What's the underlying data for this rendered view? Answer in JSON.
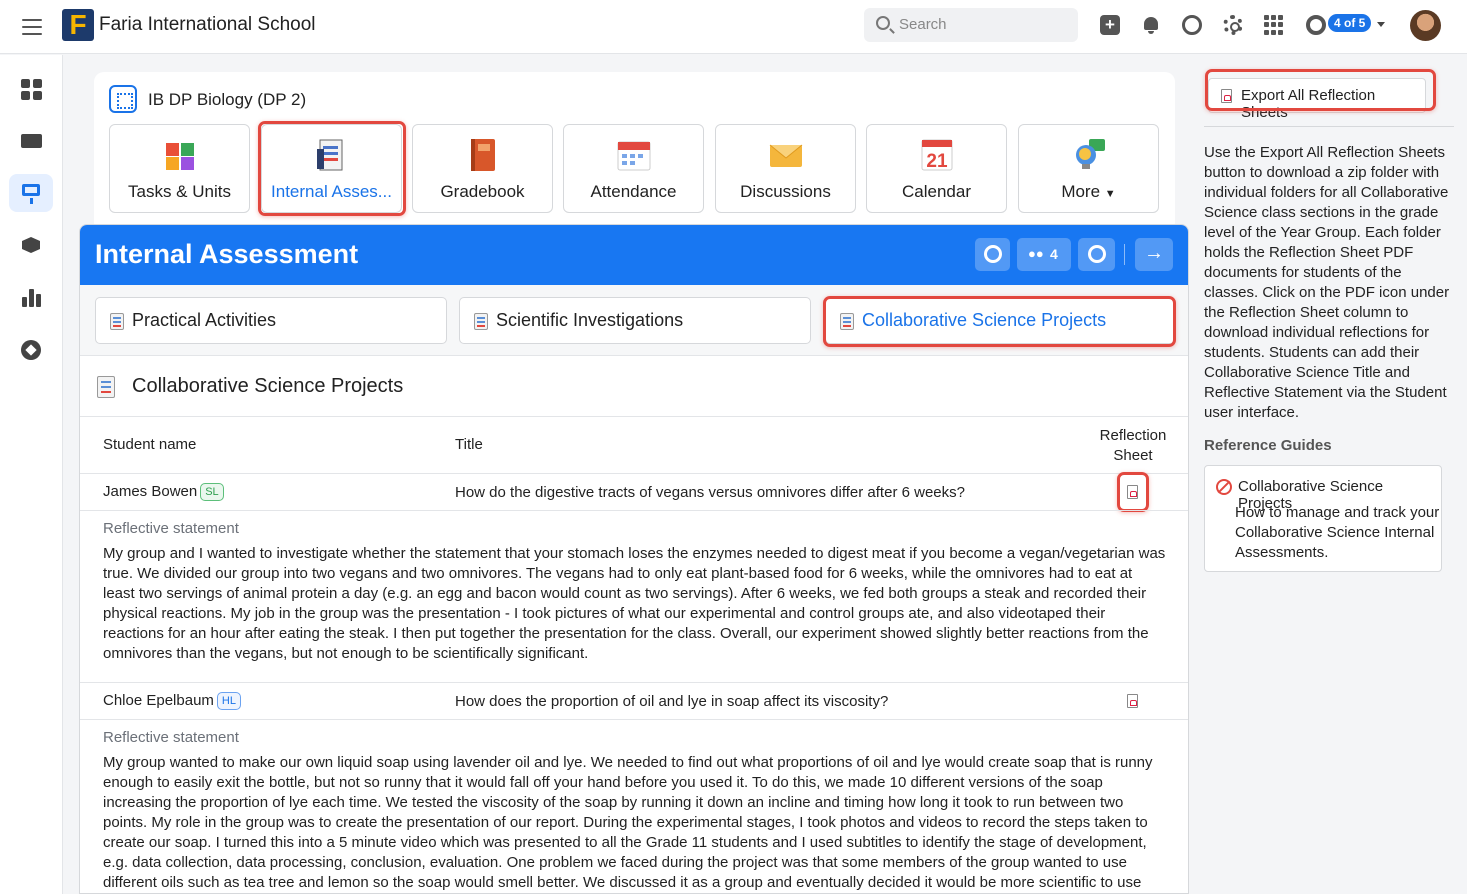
{
  "app": {
    "school_name": "Faria International School",
    "search_placeholder": "Search",
    "pagination_badge": "4 of 5"
  },
  "class": {
    "title": "IB DP Biology (DP 2)"
  },
  "tiles": [
    {
      "label": "Tasks & Units",
      "icon": "puzzle-icon"
    },
    {
      "label": "Internal Assessment",
      "display": "Internal Asses...",
      "icon": "clipboard-icon"
    },
    {
      "label": "Gradebook",
      "icon": "gradebook-icon"
    },
    {
      "label": "Attendance",
      "icon": "attendance-calendar-icon"
    },
    {
      "label": "Discussions",
      "icon": "envelope-icon"
    },
    {
      "label": "Calendar",
      "icon": "calendar-icon",
      "day": "21"
    },
    {
      "label": "More",
      "icon": "lightbulb-icon"
    }
  ],
  "ia": {
    "title": "Internal Assessment",
    "group_count": "4",
    "tabs": [
      "Practical Activities",
      "Scientific Investigations",
      "Collaborative Science Projects"
    ],
    "section_title": "Collaborative Science Projects",
    "columns": {
      "student": "Student name",
      "title": "Title",
      "reflection_line1": "Reflection",
      "reflection_line2": "Sheet"
    },
    "reflective_label": "Reflective statement",
    "rows": [
      {
        "student": "James Bowen",
        "level": "SL",
        "title": "How do the digestive tracts of vegans versus omnivores differ after 6 weeks?",
        "statement": "My group and I wanted to investigate whether the statement that your stomach loses the enzymes needed to digest meat if you become a vegan/vegetarian was true. We divided our group into two vegans and two omnivores. The vegans had to only eat plant-based food for 6 weeks, while the omnivores had to eat at least two servings of animal protein a day (e.g. an egg and bacon would count as two servings). After 6 weeks, we fed both groups a steak and recorded their physical reactions. My job in the group was the presentation - I took pictures of what our experimental and control groups ate, and also videotaped their reactions for an hour after eating the steak. I then put together the presentation for the class. Overall, our experiment showed slightly better reactions from the omnivores than the vegans, but not enough to be scientifically significant."
      },
      {
        "student": "Chloe Epelbaum",
        "level": "HL",
        "title": "How does the proportion of oil and lye in soap affect its viscosity?",
        "statement": "My group wanted to make our own liquid soap using lavender oil and lye. We needed to find out what proportions of oil and lye would create soap that is runny enough to easily exit the bottle, but not so runny that it would fall off your hand before you used it. To do this, we made 10 different versions of the soap increasing the proportion of lye each time. We tested the viscosity of the soap by running it down an incline and timing how long it took to run between two points. My role in the group was to create the presentation of our report. During the experimental stages, I took photos and videos to record the steps taken to create our soap. I turned this into a 5 minute video which was presented to all the Grade 11 students and I used subtitles to identify the stage of development, e.g. data collection, data processing, conclusion, evaluation. One problem we faced during the project was that some members of the group wanted to use different oils such as tea tree and lemon so the soap would smell better. We discussed it as a group and eventually decided it would be more scientific to use"
      }
    ]
  },
  "sidebar_right": {
    "export_button": "Export All Reflection Sheets",
    "info": "Use the Export All Reflection Sheets button to download a zip folder with individual folders for all Collaborative Science class sections in the grade level of the Year Group. Each folder holds the Reflection Sheet PDF documents for students of the classes. Click on the PDF icon under the Reflection Sheet column to download individual reflections for students. Students can add their Collaborative Science Title and Reflective Statement via the Student user interface.",
    "reference_heading": "Reference Guides",
    "guide_title": "Collaborative Science Projects",
    "guide_desc": "How to manage and track your Collaborative Science Internal Assessments."
  },
  "colors": {
    "primary": "#1877f2",
    "highlight": "#e2483f",
    "sl": "#2e9e4f",
    "hl": "#1a73e8"
  }
}
